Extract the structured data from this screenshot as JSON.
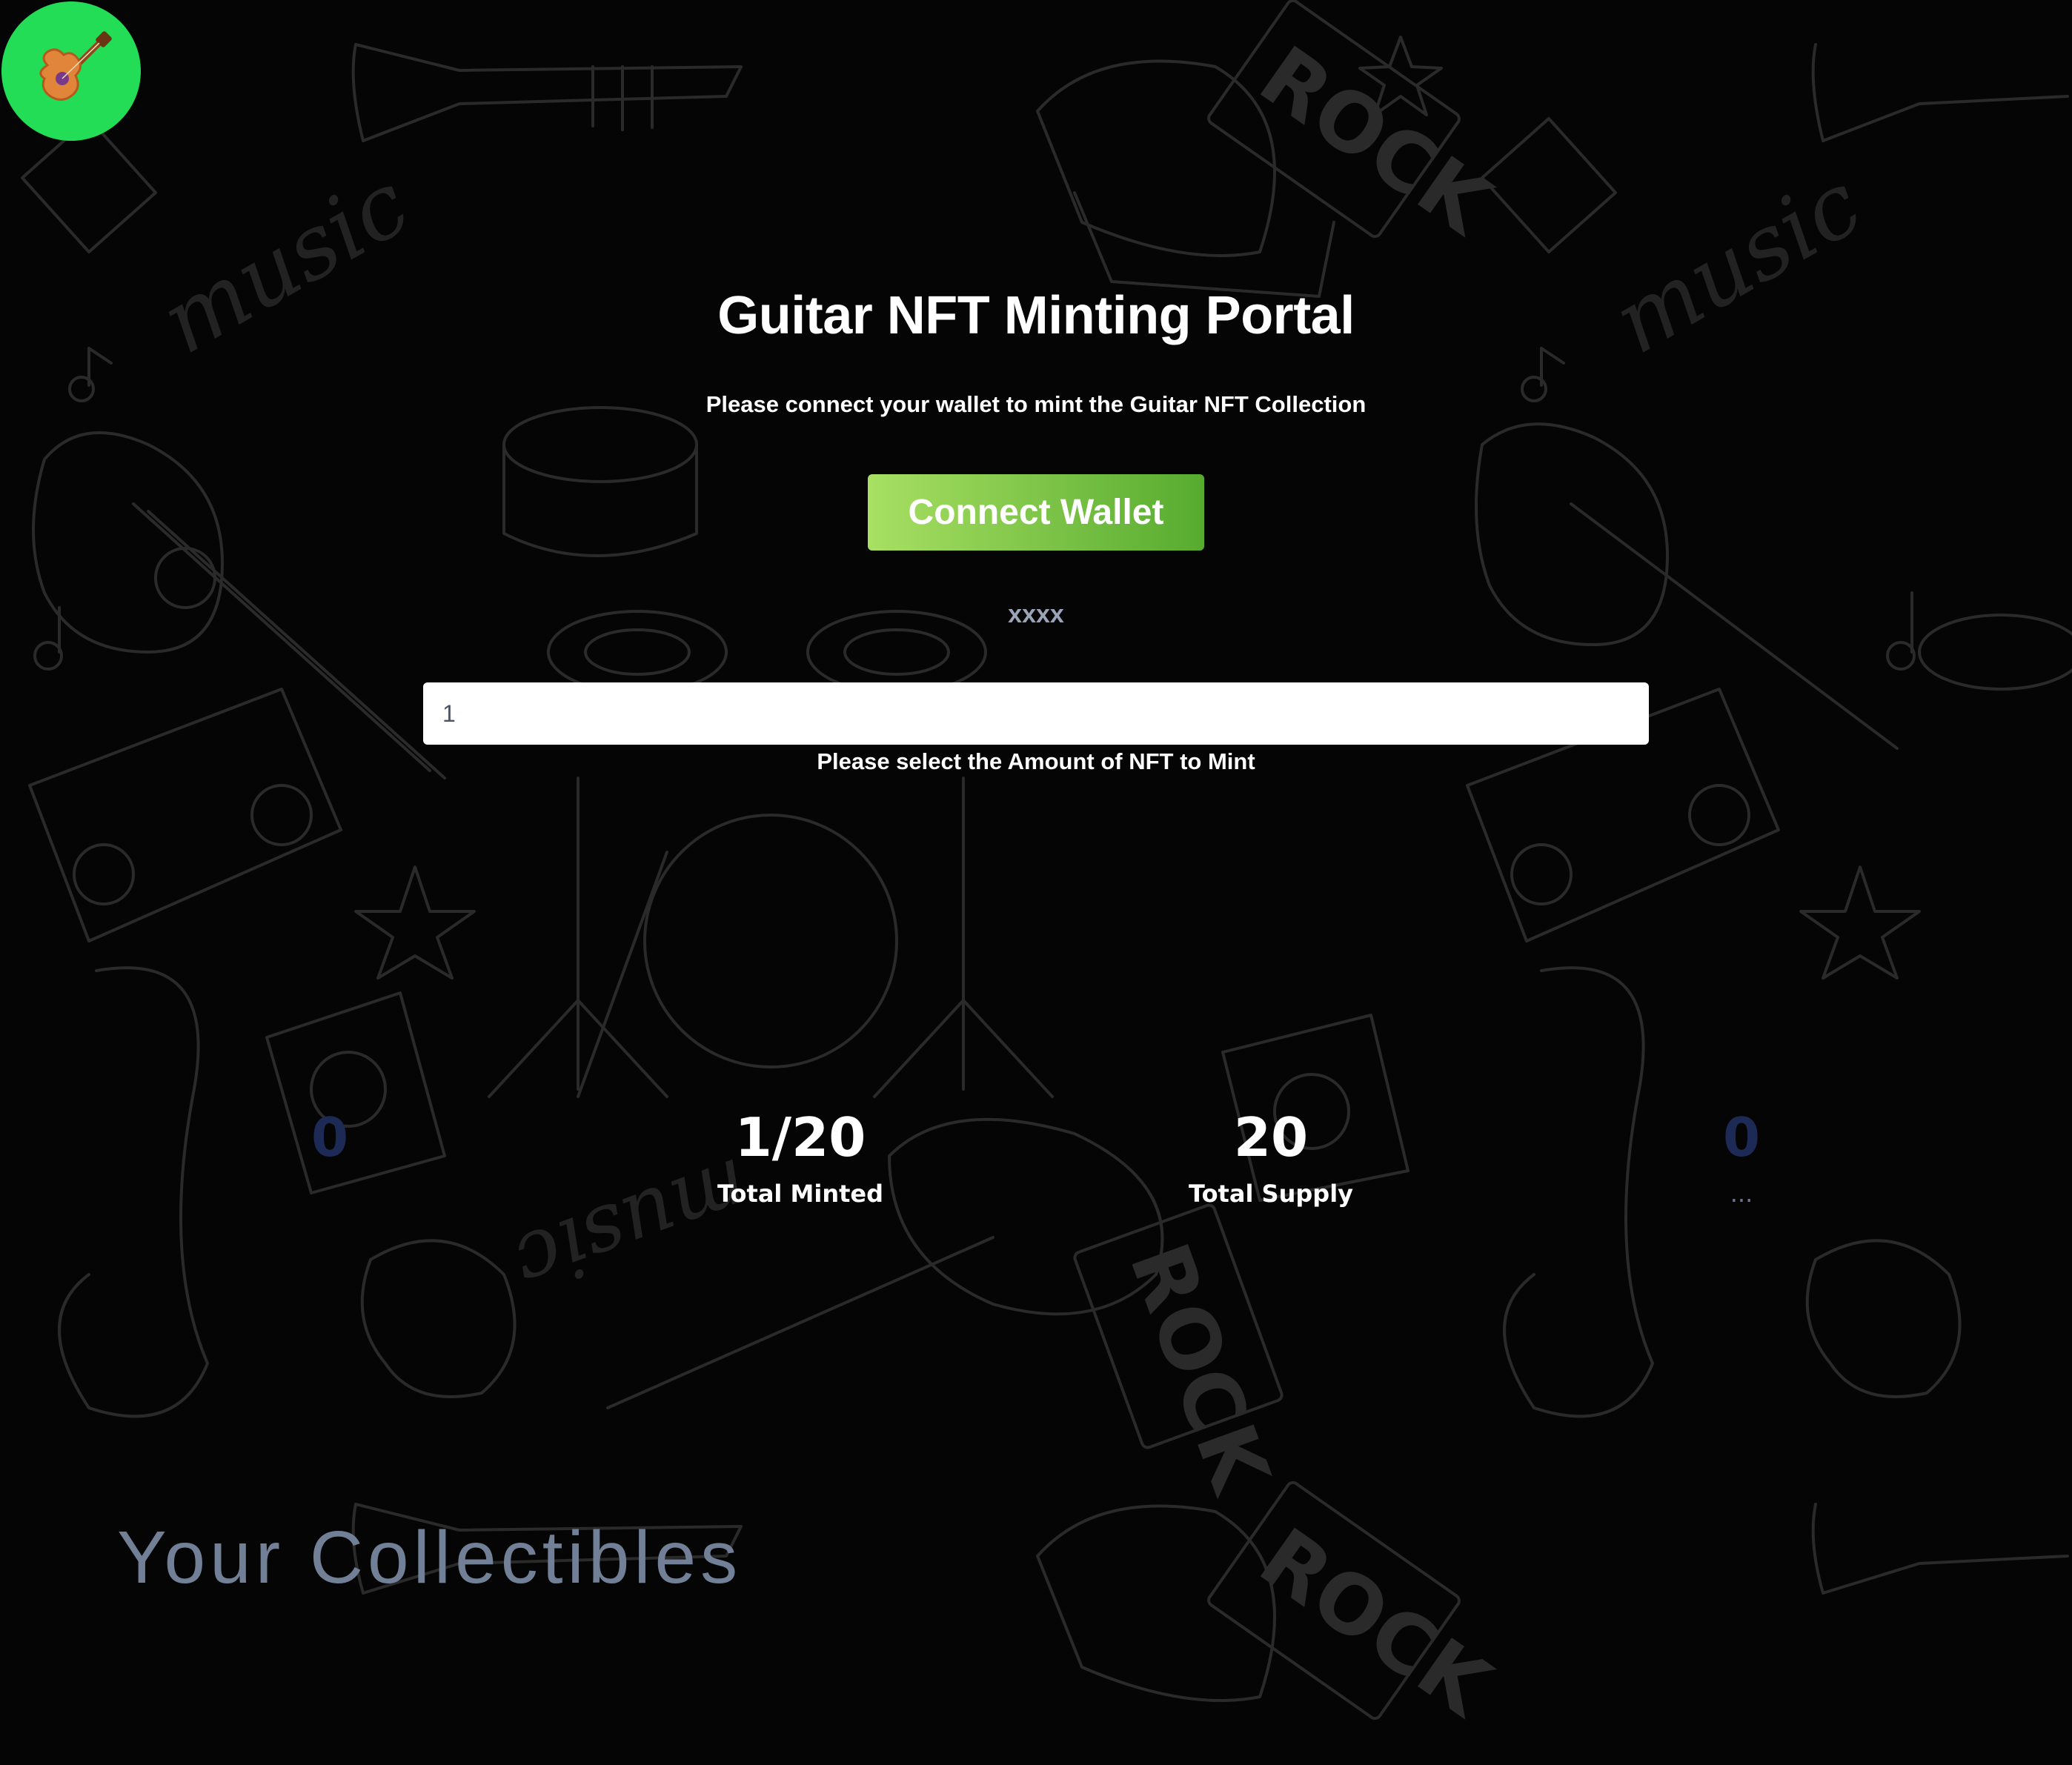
{
  "logo": {
    "icon": "guitar-icon",
    "background": "#22dd55"
  },
  "header": {
    "title": "Guitar NFT Minting Portal",
    "subtitle": "Please connect your wallet to mint the Guitar NFT Collection"
  },
  "wallet": {
    "connect_label": "Connect Wallet",
    "status": "xxxx"
  },
  "mint": {
    "amount_value": "1",
    "help": "Please select the Amount of NFT to Mint"
  },
  "stats": [
    {
      "value": "0",
      "label": ""
    },
    {
      "value": "1/20",
      "label": "Total Minted"
    },
    {
      "value": "20",
      "label": "Total Supply"
    },
    {
      "value": "0",
      "label": "..."
    }
  ],
  "collectibles": {
    "heading": "Your Collectibles"
  },
  "colors": {
    "background": "#050505",
    "button_gradient_start": "#a8e063",
    "button_gradient_end": "#56ab2f",
    "accent_green": "#22dd55"
  }
}
